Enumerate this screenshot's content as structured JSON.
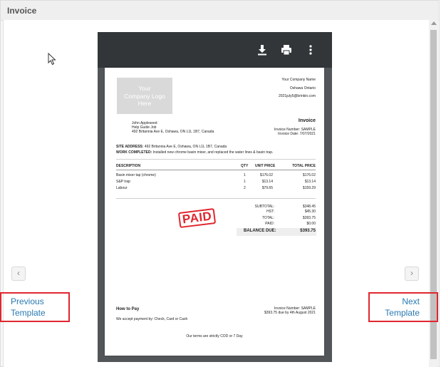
{
  "panel": {
    "title": "Invoice"
  },
  "nav": {
    "previous_label_1": "Previous",
    "previous_label_2": "Template",
    "next_label_1": "Next",
    "next_label_2": "Template",
    "prev_arrow": "‹",
    "next_arrow": "›"
  },
  "toolbar": {
    "icons": [
      "download-icon",
      "print-icon",
      "more-vert-icon"
    ]
  },
  "invoice": {
    "logo_line1": "Your",
    "logo_line2": "Company Logo",
    "logo_line3": "Here",
    "company_name": "Your Company Name",
    "company_city": "Oshawa Ontario",
    "company_email": "2021july5@brinkin.com",
    "client_name": "John Appleseed",
    "client_job": "Help Guide Job",
    "client_address": "492 Britannia Ave E, Oshawa, ON L1L 1B7, Canada",
    "doc_title": "Invoice",
    "invoice_number": "Invoice Number: SAMPLE",
    "invoice_date": "Invoice Date: 7/07/2021",
    "site_address_label": "SITE ADDRESS:",
    "site_address": "492 Britannia Ave E, Oshawa, ON L1L 1B7, Canada",
    "work_label": "WORK COMPLETED:",
    "work_text": "Installed new chrome basin mixer, and replaced the water lines & basin trap.",
    "columns": {
      "description": "DESCRIPTION",
      "qty": "QTY",
      "unit_price": "UNIT PRICE",
      "total_price": "TOTAL PRICE"
    },
    "items": [
      {
        "description": "Basin mixer tap (chrome)",
        "qty": "1",
        "unit": "$176.02",
        "total": "$176.02"
      },
      {
        "description": "S&P trap",
        "qty": "1",
        "unit": "$13.14",
        "total": "$13.14"
      },
      {
        "description": "Labour",
        "qty": "2",
        "unit": "$79.65",
        "total": "$159.29"
      }
    ],
    "totals": {
      "subtotal_label": "SUBTOTAL:",
      "subtotal": "$348.45",
      "hst_label": "HST:",
      "hst": "$45.30",
      "total_label": "TOTAL:",
      "total": "$393.75",
      "paid_label": "PAID:",
      "paid": "$0.00",
      "balance_label": "BALANCE DUE:",
      "balance": "$393.75"
    },
    "stamp": "PAID",
    "how_to_pay": "How to Pay",
    "payment_methods": "We accept payment by: Check, Card or Cash",
    "footer_invoice_number": "Invoice Number: SAMPLE",
    "footer_due": "$393.75 due by 4th August 2021",
    "terms": "Our terms are strictly COD or 7 Day"
  }
}
